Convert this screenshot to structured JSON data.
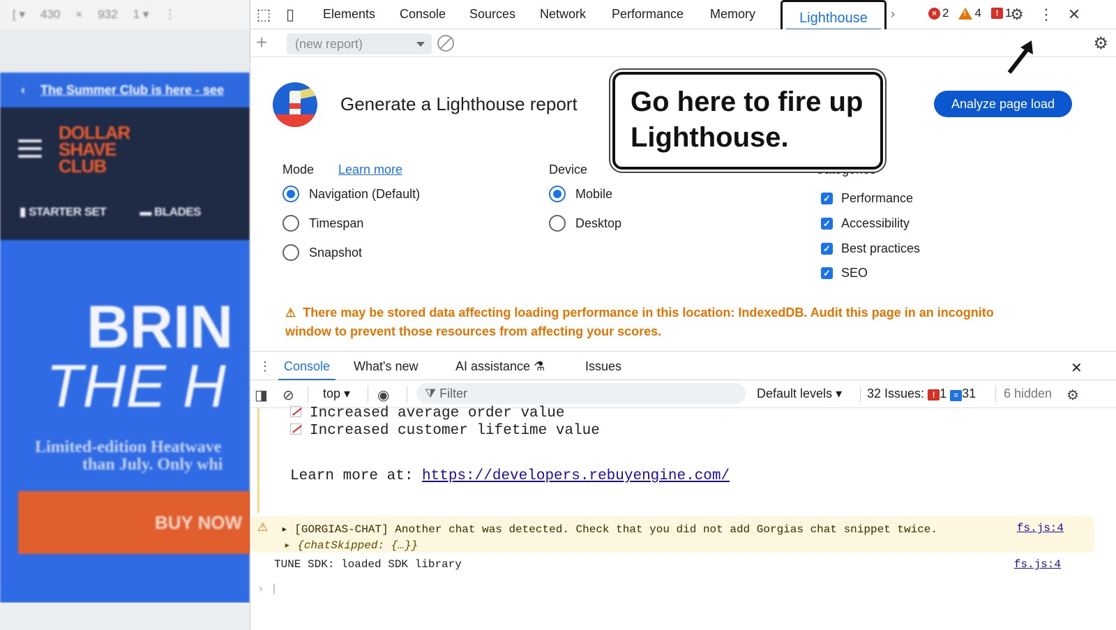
{
  "page_preview": {
    "toolbar": {
      "width": "430",
      "times": "×",
      "height": "932",
      "zoom": "1"
    },
    "promo_text": "The Summer Club is here - see",
    "logo_lines": [
      "DOLLAR",
      "SHAVE",
      "CLUB"
    ],
    "nav_items": [
      "STARTER SET",
      "BLADES"
    ],
    "hero_line1": "BRIN",
    "hero_line2": "THE H",
    "hero_sub_line1": "Limited-edition Heatwave",
    "hero_sub_line2": "than July. Only whi",
    "buy_label": "BUY NOW"
  },
  "devtools": {
    "tabs": [
      "Elements",
      "Console",
      "Sources",
      "Network",
      "Performance",
      "Memory"
    ],
    "active_tab": "Lighthouse",
    "error_count": "2",
    "warning_count": "4",
    "issue_count": "1",
    "report_select": "(new report)"
  },
  "lighthouse": {
    "title": "Generate a Lighthouse report",
    "analyze_button": "Analyze page load",
    "mode_label": "Mode",
    "learn_more": "Learn more",
    "modes": [
      "Navigation (Default)",
      "Timespan",
      "Snapshot"
    ],
    "device_label": "Device",
    "devices": [
      "Mobile",
      "Desktop"
    ],
    "categories_label": "Categories",
    "categories": [
      "Performance",
      "Accessibility",
      "Best practices",
      "SEO"
    ],
    "warning_line1": "There may be stored data affecting loading performance in this location: IndexedDB. Audit this page in an incognito",
    "warning_line2": "window to prevent those resources from affecting your scores."
  },
  "callout": {
    "line1": "Go here to fire up",
    "line2": "Lighthouse."
  },
  "drawer": {
    "tabs": [
      "Console",
      "What's new",
      "AI assistance",
      "Issues"
    ],
    "context": "top",
    "filter_placeholder": "Filter",
    "levels": "Default levels",
    "issues_label": "32 Issues:",
    "issues_red": "1",
    "issues_blue": "31",
    "hidden": "6 hidden"
  },
  "console": {
    "line1": "Increased average order value",
    "line2": "Increased customer lifetime value",
    "learn_prefix": "Learn more at: ",
    "learn_url": "https://developers.rebuyengine.com/",
    "warn_text": "[GORGIAS-CHAT] Another chat was detected. Check that you did not add Gorgias chat snippet twice.",
    "warn_sub": "{chatSkipped: {…}}",
    "warn_source": "fs.js:4",
    "tune_text": "TUNE SDK: loaded SDK library",
    "tune_source": "fs.js:4"
  },
  "colors": {
    "accent": "#1a73e8",
    "warning": "#e37400",
    "error": "#d93025"
  }
}
